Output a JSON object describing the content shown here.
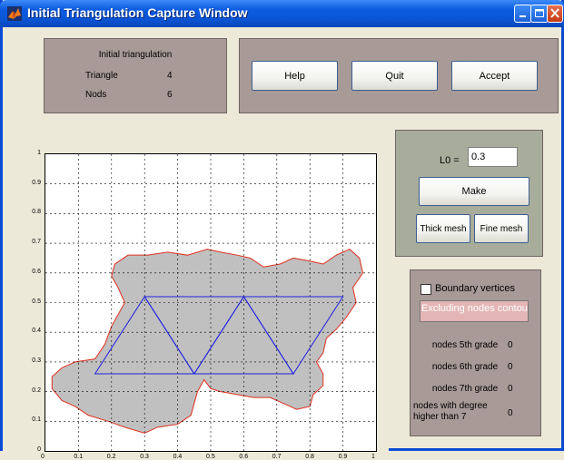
{
  "window": {
    "title": "Initial Triangulation Capture Window"
  },
  "info_panel": {
    "heading": "Initial triangulation",
    "triangle_label": "Triangle",
    "triangle_value": "4",
    "nods_label": "Nods",
    "nods_value": "6"
  },
  "buttons": {
    "help": "Help",
    "quit": "Quit",
    "accept": "Accept"
  },
  "mesh_panel": {
    "l0_label": "L0 =",
    "l0_value": "0.3",
    "make": "Make",
    "thick_mesh": "Thick mesh",
    "fine_mesh": "Fine mesh"
  },
  "boundary_panel": {
    "checkbox_label": "Boundary vertices",
    "checkbox_checked": false,
    "excluding_text": "Excluding nodes contour",
    "rows": [
      {
        "label": "nodes 5th grade",
        "value": "0"
      },
      {
        "label": "nodes 6th grade",
        "value": "0"
      },
      {
        "label": "nodes 7th grade",
        "value": "0"
      },
      {
        "label": "nodes with degree higher than 7",
        "value": "0"
      }
    ]
  },
  "plot": {
    "x_ticks": [
      "0",
      "0.1",
      "0.2",
      "0.3",
      "0.4",
      "0.5",
      "0.6",
      "0.7",
      "0.8",
      "0.9",
      "1"
    ],
    "y_ticks": [
      "0",
      "0.1",
      "0.2",
      "0.3",
      "0.4",
      "0.5",
      "0.6",
      "0.7",
      "0.8",
      "0.9",
      "1"
    ],
    "xlim": [
      0,
      1
    ],
    "ylim": [
      0,
      1
    ],
    "grid": "dashed",
    "region_fill": "#c0c0c0",
    "boundary_color": "#e0301e",
    "mesh_color": "#1f1fe0",
    "nodes": [
      [
        0.15,
        0.26
      ],
      [
        0.45,
        0.26
      ],
      [
        0.75,
        0.26
      ],
      [
        0.3,
        0.52
      ],
      [
        0.6,
        0.52
      ],
      [
        0.9,
        0.52
      ]
    ],
    "triangles": [
      [
        0,
        1,
        3
      ],
      [
        1,
        4,
        3
      ],
      [
        1,
        2,
        4
      ],
      [
        2,
        5,
        4
      ]
    ],
    "boundary": [
      [
        0.02,
        0.25
      ],
      [
        0.05,
        0.28
      ],
      [
        0.09,
        0.3
      ],
      [
        0.15,
        0.31
      ],
      [
        0.18,
        0.36
      ],
      [
        0.2,
        0.42
      ],
      [
        0.22,
        0.46
      ],
      [
        0.24,
        0.5
      ],
      [
        0.22,
        0.55
      ],
      [
        0.2,
        0.59
      ],
      [
        0.21,
        0.63
      ],
      [
        0.25,
        0.66
      ],
      [
        0.31,
        0.66
      ],
      [
        0.37,
        0.67
      ],
      [
        0.43,
        0.66
      ],
      [
        0.49,
        0.68
      ],
      [
        0.53,
        0.67
      ],
      [
        0.58,
        0.66
      ],
      [
        0.62,
        0.65
      ],
      [
        0.66,
        0.62
      ],
      [
        0.71,
        0.63
      ],
      [
        0.75,
        0.65
      ],
      [
        0.8,
        0.64
      ],
      [
        0.84,
        0.63
      ],
      [
        0.88,
        0.66
      ],
      [
        0.92,
        0.68
      ],
      [
        0.95,
        0.65
      ],
      [
        0.96,
        0.6
      ],
      [
        0.93,
        0.55
      ],
      [
        0.94,
        0.5
      ],
      [
        0.91,
        0.45
      ],
      [
        0.88,
        0.41
      ],
      [
        0.85,
        0.38
      ],
      [
        0.84,
        0.33
      ],
      [
        0.82,
        0.3
      ],
      [
        0.84,
        0.26
      ],
      [
        0.84,
        0.22
      ],
      [
        0.81,
        0.19
      ],
      [
        0.8,
        0.15
      ],
      [
        0.76,
        0.14
      ],
      [
        0.72,
        0.16
      ],
      [
        0.68,
        0.18
      ],
      [
        0.63,
        0.18
      ],
      [
        0.58,
        0.19
      ],
      [
        0.53,
        0.2
      ],
      [
        0.5,
        0.21
      ],
      [
        0.48,
        0.24
      ],
      [
        0.46,
        0.2
      ],
      [
        0.44,
        0.12
      ],
      [
        0.4,
        0.09
      ],
      [
        0.34,
        0.08
      ],
      [
        0.3,
        0.06
      ],
      [
        0.24,
        0.08
      ],
      [
        0.19,
        0.1
      ],
      [
        0.13,
        0.12
      ],
      [
        0.09,
        0.15
      ],
      [
        0.05,
        0.17
      ],
      [
        0.02,
        0.21
      ]
    ]
  }
}
